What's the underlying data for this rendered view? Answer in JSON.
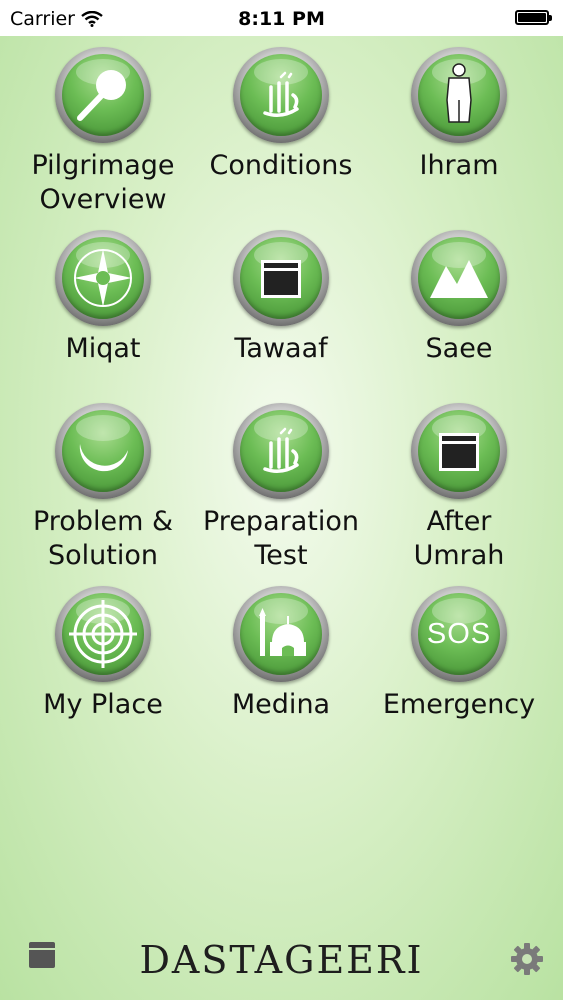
{
  "status_bar": {
    "carrier": "Carrier",
    "time": "8:11 PM",
    "battery_level": 1.0
  },
  "tiles": [
    {
      "label": "Pilgrimage\nOverview",
      "icon": "magnifier-icon"
    },
    {
      "label": "Conditions",
      "icon": "calligraphy-icon"
    },
    {
      "label": "Ihram",
      "icon": "pilgrim-icon"
    },
    {
      "label": "Miqat",
      "icon": "compass-icon"
    },
    {
      "label": "Tawaaf",
      "icon": "kaaba-icon"
    },
    {
      "label": "Saee",
      "icon": "mountains-icon"
    },
    {
      "label": "Problem &\nSolution",
      "icon": "crescent-icon"
    },
    {
      "label": "Preparation\nTest",
      "icon": "calligraphy-icon"
    },
    {
      "label": "After\nUmrah",
      "icon": "kaaba-icon"
    },
    {
      "label": "My Place",
      "icon": "target-icon"
    },
    {
      "label": "Medina",
      "icon": "mosque-icon"
    },
    {
      "label": "Emergency",
      "icon": "sos-icon",
      "icon_text": "SOS"
    }
  ],
  "bottom_bar": {
    "logo": "DASTAGEERI",
    "menu_icon": "menu-icon",
    "settings_icon": "gear-icon"
  },
  "colors": {
    "button_green": "#6cbd55",
    "background_green": "#b9e2a2"
  }
}
